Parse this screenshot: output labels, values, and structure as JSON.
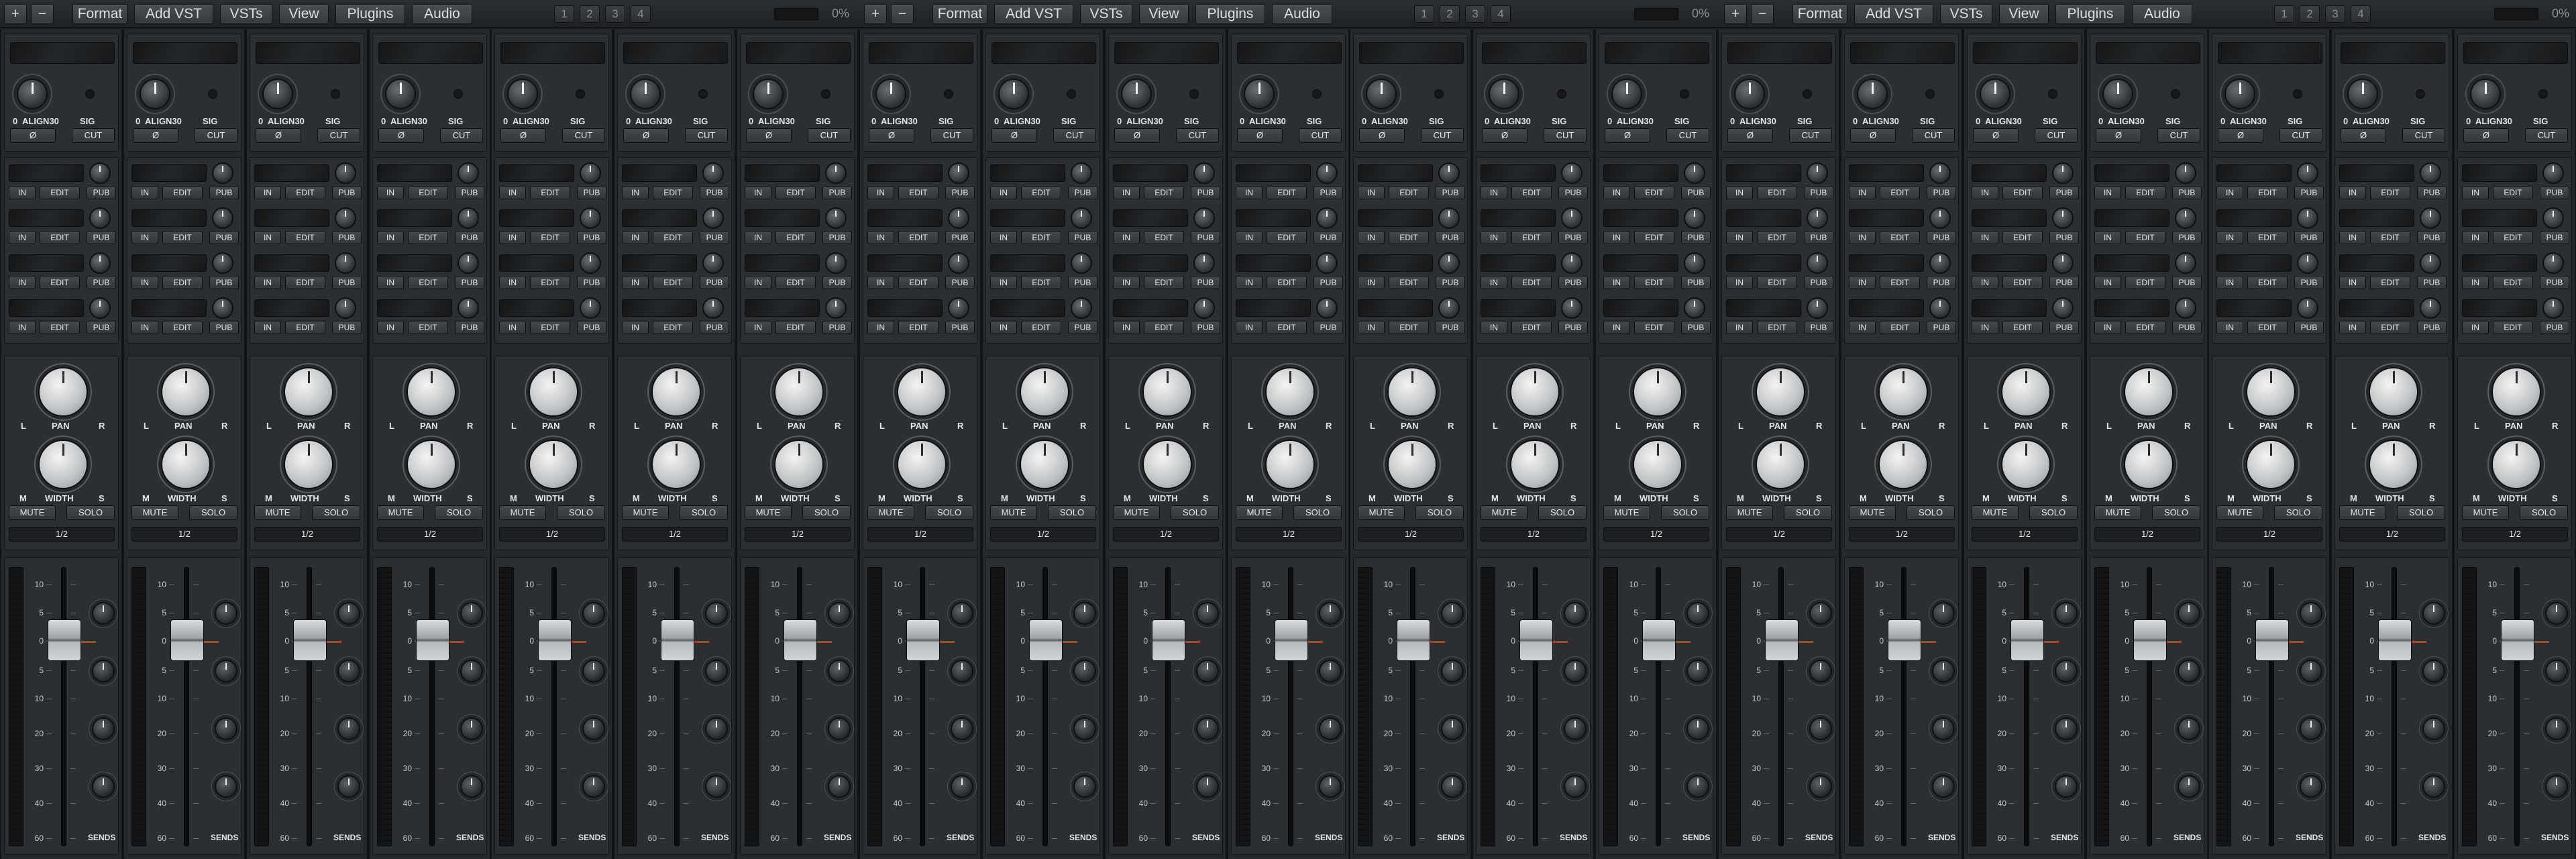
{
  "toolbar": {
    "groups": [
      {
        "add": "+",
        "remove": "−",
        "buttons": [
          "Format",
          "Add VST",
          "VSTs",
          "View",
          "Plugins",
          "Audio"
        ],
        "pages": [
          "1",
          "2",
          "3",
          "4"
        ],
        "cpu": "0%"
      },
      {
        "add": "+",
        "remove": "−",
        "buttons": [
          "Format",
          "Add VST",
          "VSTs",
          "View",
          "Plugins",
          "Audio"
        ],
        "pages": [
          "1",
          "2",
          "3",
          "4"
        ],
        "cpu": "0%"
      },
      {
        "add": "+",
        "remove": "−",
        "buttons": [
          "Format",
          "Add VST",
          "VSTs",
          "View",
          "Plugins",
          "Audio"
        ],
        "pages": [
          "1",
          "2",
          "3",
          "4"
        ],
        "cpu": "0%"
      }
    ]
  },
  "strip": {
    "count": 21,
    "knob_value": "0",
    "align_label": "ALIGN30",
    "sig_label": "SIG",
    "phase_label": "Ø",
    "cut_label": "CUT",
    "slot_buttons": [
      "IN",
      "EDIT",
      "PUB"
    ],
    "slot_count": 4,
    "pan_left": "L",
    "pan_label": "PAN",
    "pan_right": "R",
    "width_left": "M",
    "width_label": "WIDTH",
    "width_right": "S",
    "mute_label": "MUTE",
    "solo_label": "SOLO",
    "route_label": "1/2",
    "fader_scale": [
      "10",
      "5",
      "0",
      "5",
      "10",
      "20",
      "30",
      "40",
      "60"
    ],
    "sends_label": "SENDS"
  },
  "colors": {
    "unity_marker": "#c0392b",
    "background": "#1e2022",
    "panel": "#2c2f32"
  }
}
